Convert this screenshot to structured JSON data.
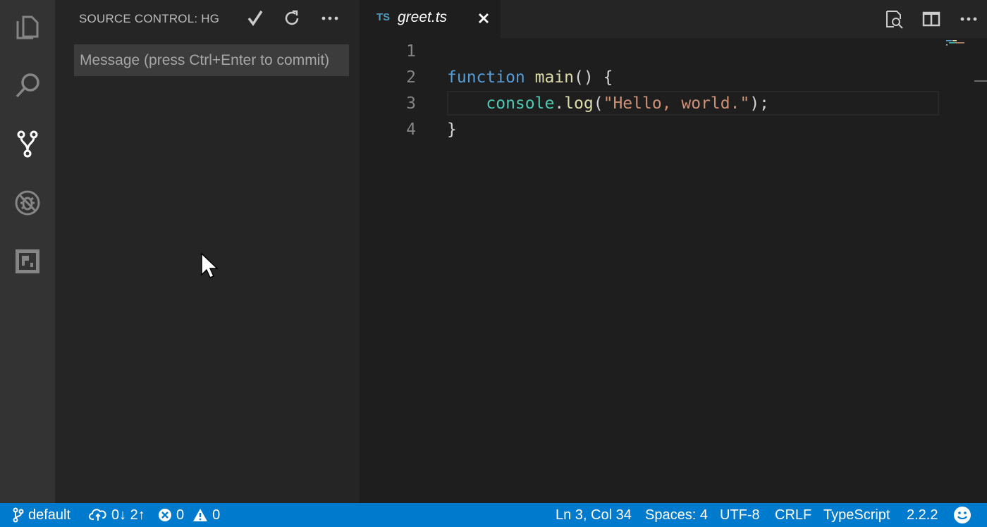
{
  "activity_bar": {
    "items": [
      {
        "icon": "files-icon"
      },
      {
        "icon": "search-icon"
      },
      {
        "icon": "source-control-icon",
        "active": true
      },
      {
        "icon": "debug-icon"
      },
      {
        "icon": "extensions-icon"
      }
    ]
  },
  "sidebar": {
    "title": "SOURCE CONTROL: HG",
    "actions": [
      "commit-icon",
      "refresh-icon",
      "more-icon"
    ],
    "commit_placeholder": "Message (press Ctrl+Enter to commit)"
  },
  "editor": {
    "tab": {
      "lang_badge": "TS",
      "label": "greet.ts"
    },
    "actions": [
      "open-changes-icon",
      "split-editor-icon",
      "more-icon"
    ],
    "lines": [
      {
        "n": "1",
        "parts": []
      },
      {
        "n": "2",
        "parts": [
          {
            "t": "function",
            "c": "kw"
          },
          {
            "t": " ",
            "c": ""
          },
          {
            "t": "main",
            "c": "fn"
          },
          {
            "t": "() {",
            "c": ""
          }
        ]
      },
      {
        "n": "3",
        "parts": [
          {
            "t": "    ",
            "c": ""
          },
          {
            "t": "console",
            "c": "obj"
          },
          {
            "t": ".",
            "c": ""
          },
          {
            "t": "log",
            "c": "fn"
          },
          {
            "t": "(",
            "c": ""
          },
          {
            "t": "\"Hello, world.\"",
            "c": "str"
          },
          {
            "t": ");",
            "c": ""
          }
        ],
        "current": true
      },
      {
        "n": "4",
        "parts": [
          {
            "t": "}",
            "c": ""
          }
        ]
      }
    ]
  },
  "statusbar": {
    "branch": "default",
    "sync": "0↓ 2↑",
    "errors": "0",
    "warnings": "0",
    "position": "Ln 3, Col 34",
    "spaces": "Spaces: 4",
    "encoding": "UTF-8",
    "eol": "CRLF",
    "language": "TypeScript",
    "version": "2.2.2"
  },
  "colors": {
    "statusbar_bg": "#007acc",
    "activity_bg": "#333333",
    "sidebar_bg": "#252526",
    "editor_bg": "#1e1e1e"
  }
}
